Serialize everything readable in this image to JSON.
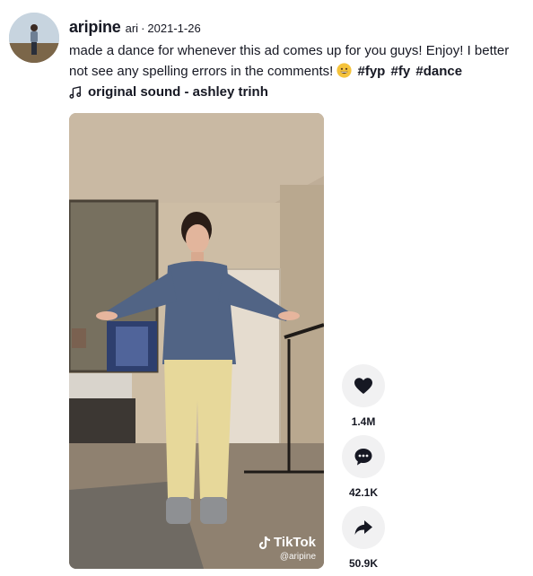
{
  "post": {
    "username": "aripine",
    "nickname": "ari",
    "separator": "·",
    "date": "2021-1-26",
    "caption": "made a dance for whenever this ad comes up for you guys! Enjoy! I better not see any spelling errors in the comments!",
    "emoji": "grinning-face-emoji",
    "hashtags": [
      "#fyp",
      "#fy",
      "#dance"
    ],
    "music": "original sound - ashley trinh"
  },
  "video": {
    "watermark_brand": "TikTok",
    "watermark_handle": "@aripine"
  },
  "actions": {
    "likes": "1.4M",
    "comments": "42.1K",
    "shares": "50.9K"
  },
  "icons": {
    "like": "heart-icon",
    "comment": "comment-bubble-icon",
    "share": "share-arrow-icon",
    "music": "music-note-icon",
    "brand": "tiktok-logo-icon"
  },
  "colors": {
    "text": "#161823",
    "button_bg": "#f1f1f2",
    "watermark": "#ffffff"
  }
}
